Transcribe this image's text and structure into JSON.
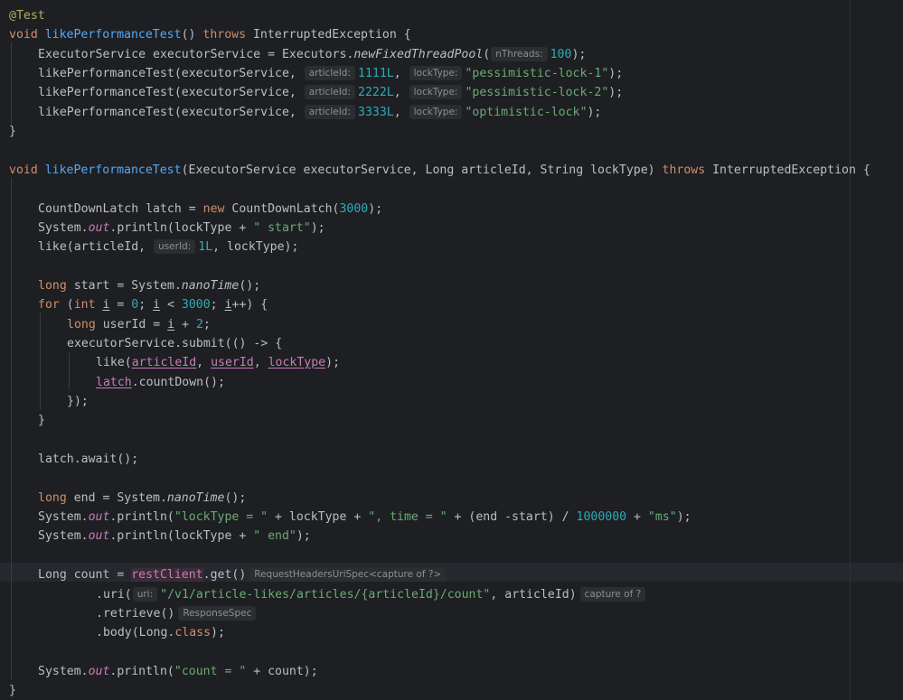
{
  "colors": {
    "background": "#1e1f22",
    "keyword": "#cf8e6d",
    "function": "#56a8f5",
    "annotation": "#b3ae60",
    "number": "#2aacb8",
    "string": "#6aab73",
    "static_field": "#c77dbb",
    "plain": "#bcbec4",
    "hint_text": "#8c8f94"
  },
  "code": {
    "lines": [
      {
        "indent": 0,
        "tokens": [
          {
            "k": "ann",
            "t": "@Test"
          }
        ]
      },
      {
        "indent": 0,
        "tokens": [
          {
            "k": "kw",
            "t": "void "
          },
          {
            "k": "fn",
            "t": "likePerformanceTest"
          },
          {
            "t": "() "
          },
          {
            "k": "kw",
            "t": "throws "
          },
          {
            "t": "InterruptedException {"
          }
        ]
      },
      {
        "indent": 1,
        "tokens": [
          {
            "t": "ExecutorService executorService = Executors."
          },
          {
            "k": "italic",
            "t": "newFixedThreadPool"
          },
          {
            "t": "("
          },
          {
            "k": "hint",
            "t": "nThreads:"
          },
          {
            "k": "num",
            "t": "100"
          },
          {
            "t": ");"
          }
        ]
      },
      {
        "indent": 1,
        "tokens": [
          {
            "t": "likePerformanceTest(executorService, "
          },
          {
            "k": "hint",
            "t": "articleId:"
          },
          {
            "k": "num",
            "t": "1111L"
          },
          {
            "t": ", "
          },
          {
            "k": "hint",
            "t": "lockType:"
          },
          {
            "k": "str",
            "t": "\"pessimistic-lock-1\""
          },
          {
            "t": ");"
          }
        ]
      },
      {
        "indent": 1,
        "tokens": [
          {
            "t": "likePerformanceTest(executorService, "
          },
          {
            "k": "hint",
            "t": "articleId:"
          },
          {
            "k": "num",
            "t": "2222L"
          },
          {
            "t": ", "
          },
          {
            "k": "hint",
            "t": "lockType:"
          },
          {
            "k": "str",
            "t": "\"pessimistic-lock-2\""
          },
          {
            "t": ");"
          }
        ]
      },
      {
        "indent": 1,
        "tokens": [
          {
            "t": "likePerformanceTest(executorService, "
          },
          {
            "k": "hint",
            "t": "articleId:"
          },
          {
            "k": "num",
            "t": "3333L"
          },
          {
            "t": ", "
          },
          {
            "k": "hint",
            "t": "lockType:"
          },
          {
            "k": "str",
            "t": "\"optimistic-lock\""
          },
          {
            "t": ");"
          }
        ]
      },
      {
        "indent": 0,
        "tokens": [
          {
            "t": "}"
          }
        ]
      },
      {
        "indent": 0,
        "tokens": []
      },
      {
        "indent": 0,
        "tokens": [
          {
            "k": "kw",
            "t": "void "
          },
          {
            "k": "fn",
            "t": "likePerformanceTest"
          },
          {
            "t": "(ExecutorService executorService, Long articleId, String lockType) "
          },
          {
            "k": "kw",
            "t": "throws "
          },
          {
            "t": "InterruptedException {"
          }
        ]
      },
      {
        "indent": 0,
        "tokens": []
      },
      {
        "indent": 1,
        "tokens": [
          {
            "t": "CountDownLatch latch = "
          },
          {
            "k": "kw",
            "t": "new "
          },
          {
            "t": "CountDownLatch("
          },
          {
            "k": "num",
            "t": "3000"
          },
          {
            "t": ");"
          }
        ]
      },
      {
        "indent": 1,
        "tokens": [
          {
            "t": "System."
          },
          {
            "k": "static",
            "t": "out"
          },
          {
            "t": ".println(lockType + "
          },
          {
            "k": "str",
            "t": "\" start\""
          },
          {
            "t": ");"
          }
        ]
      },
      {
        "indent": 1,
        "tokens": [
          {
            "t": "like(articleId, "
          },
          {
            "k": "hint",
            "t": "userId:"
          },
          {
            "k": "num",
            "t": "1L"
          },
          {
            "t": ", lockType);"
          }
        ]
      },
      {
        "indent": 0,
        "tokens": []
      },
      {
        "indent": 1,
        "tokens": [
          {
            "k": "kw",
            "t": "long "
          },
          {
            "t": "start = System."
          },
          {
            "k": "italic",
            "t": "nanoTime"
          },
          {
            "t": "();"
          }
        ]
      },
      {
        "indent": 1,
        "tokens": [
          {
            "k": "kw",
            "t": "for "
          },
          {
            "t": "("
          },
          {
            "k": "kw",
            "t": "int "
          },
          {
            "k": "ul",
            "t": "i"
          },
          {
            "t": " = "
          },
          {
            "k": "num",
            "t": "0"
          },
          {
            "t": "; "
          },
          {
            "k": "ul",
            "t": "i"
          },
          {
            "t": " < "
          },
          {
            "k": "num",
            "t": "3000"
          },
          {
            "t": "; "
          },
          {
            "k": "ul",
            "t": "i"
          },
          {
            "t": "++) {"
          }
        ]
      },
      {
        "indent": 2,
        "tokens": [
          {
            "k": "kw",
            "t": "long "
          },
          {
            "t": "userId = "
          },
          {
            "k": "ul",
            "t": "i"
          },
          {
            "t": " + "
          },
          {
            "k": "num",
            "t": "2"
          },
          {
            "t": ";"
          }
        ]
      },
      {
        "indent": 2,
        "tokens": [
          {
            "t": "executorService.submit(() -> {"
          }
        ]
      },
      {
        "indent": 3,
        "tokens": [
          {
            "t": "like("
          },
          {
            "k": "lambda",
            "t": "articleId"
          },
          {
            "t": ", "
          },
          {
            "k": "lambda",
            "t": "userId"
          },
          {
            "t": ", "
          },
          {
            "k": "lambda",
            "t": "lockType"
          },
          {
            "t": ");"
          }
        ]
      },
      {
        "indent": 3,
        "tokens": [
          {
            "k": "lambda",
            "t": "latch"
          },
          {
            "t": ".countDown();"
          }
        ]
      },
      {
        "indent": 2,
        "tokens": [
          {
            "t": "});"
          }
        ]
      },
      {
        "indent": 1,
        "tokens": [
          {
            "t": "}"
          }
        ]
      },
      {
        "indent": 0,
        "tokens": []
      },
      {
        "indent": 1,
        "tokens": [
          {
            "t": "latch.await();"
          }
        ]
      },
      {
        "indent": 0,
        "tokens": []
      },
      {
        "indent": 1,
        "tokens": [
          {
            "k": "kw",
            "t": "long "
          },
          {
            "t": "end = System."
          },
          {
            "k": "italic",
            "t": "nanoTime"
          },
          {
            "t": "();"
          }
        ]
      },
      {
        "indent": 1,
        "tokens": [
          {
            "t": "System."
          },
          {
            "k": "static",
            "t": "out"
          },
          {
            "t": ".println("
          },
          {
            "k": "str",
            "t": "\"lockType = \""
          },
          {
            "t": " + lockType + "
          },
          {
            "k": "str",
            "t": "\", time = \""
          },
          {
            "t": " + (end -start) / "
          },
          {
            "k": "num",
            "t": "1000000"
          },
          {
            "t": " + "
          },
          {
            "k": "str",
            "t": "\"ms\""
          },
          {
            "t": ");"
          }
        ]
      },
      {
        "indent": 1,
        "tokens": [
          {
            "t": "System."
          },
          {
            "k": "static",
            "t": "out"
          },
          {
            "t": ".println(lockType + "
          },
          {
            "k": "str",
            "t": "\" end\""
          },
          {
            "t": ");"
          }
        ]
      },
      {
        "indent": 0,
        "tokens": []
      },
      {
        "indent": 1,
        "tokens": [
          {
            "t": "Long count = "
          },
          {
            "k": "field",
            "t": "restClient"
          },
          {
            "t": ".get()"
          },
          {
            "k": "hinttype",
            "t": "RequestHeadersUriSpec<capture of ?>"
          }
        ]
      },
      {
        "indent": 3,
        "tokens": [
          {
            "t": ".uri("
          },
          {
            "k": "hint",
            "t": "uri:"
          },
          {
            "k": "str",
            "t": "\"/v1/article-likes/articles/{articleId}/count\""
          },
          {
            "t": ", articleId)"
          },
          {
            "k": "hinttype",
            "t": "capture of ?"
          }
        ]
      },
      {
        "indent": 3,
        "tokens": [
          {
            "t": ".retrieve()"
          },
          {
            "k": "hinttype",
            "t": "ResponseSpec"
          }
        ]
      },
      {
        "indent": 3,
        "tokens": [
          {
            "t": ".body(Long."
          },
          {
            "k": "kw",
            "t": "class"
          },
          {
            "t": ");"
          }
        ]
      },
      {
        "indent": 0,
        "tokens": []
      },
      {
        "indent": 1,
        "tokens": [
          {
            "t": "System."
          },
          {
            "k": "static",
            "t": "out"
          },
          {
            "t": ".println("
          },
          {
            "k": "str",
            "t": "\"count = \""
          },
          {
            "t": " + count);"
          }
        ]
      },
      {
        "indent": 0,
        "tokens": [
          {
            "t": "}"
          }
        ]
      }
    ]
  }
}
